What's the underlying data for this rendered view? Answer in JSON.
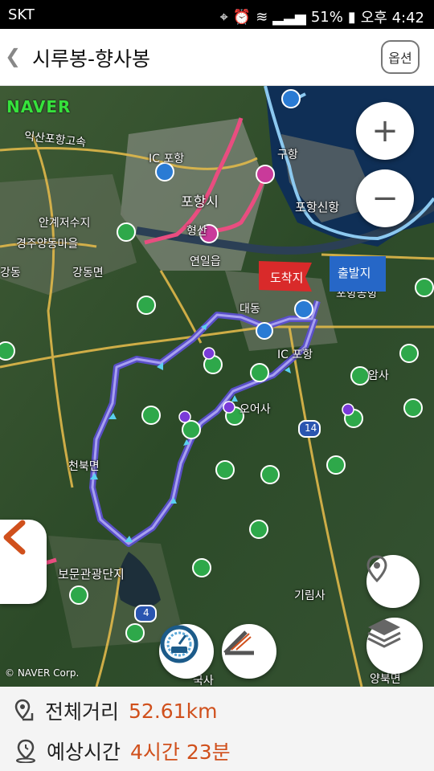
{
  "status_bar": {
    "carrier": "SKT",
    "battery": "51%",
    "time": "오후 4:42"
  },
  "app_bar": {
    "title": "시루봉-향사봉",
    "option_label": "옵션"
  },
  "map": {
    "logo": "NAVER",
    "copyright": "© NAVER Corp.",
    "labels": {
      "expressway": "익산포항고속",
      "pohang_si": "포항시",
      "gu_hang": "구항",
      "pohang_new_port": "포항신항",
      "angang_reservoir": "안계저수지",
      "gyeongju_yangdong": "경주양동마을",
      "gangdong": "강동면",
      "yeonil": "연일읍",
      "hyeongsan": "형산",
      "gangseo": "강동",
      "munmu": "대동",
      "ic": "IC 포항",
      "ic2": "IC 포항",
      "osa": "오어사",
      "amsa": "암사",
      "bomun": "보문관광단지",
      "girimsa": "기림사",
      "cheonbuk": "천북면",
      "yangbuk": "양북면",
      "pohang_airport": "포항공항",
      "gukap": "국사",
      "num14": "14",
      "num4": "4"
    },
    "flags": {
      "destination": "도착지",
      "start": "출발지"
    }
  },
  "summary": {
    "distance_label": "전체거리",
    "distance_value": "52.61km",
    "time_label": "예상시간",
    "time_value": "4시간 23분"
  },
  "colors": {
    "route": "#6a5ed6",
    "accent_orange": "#d0501c",
    "destination_flag": "#d92a2a",
    "start_flag": "#2667c7",
    "bike_road": "#e94d80"
  }
}
